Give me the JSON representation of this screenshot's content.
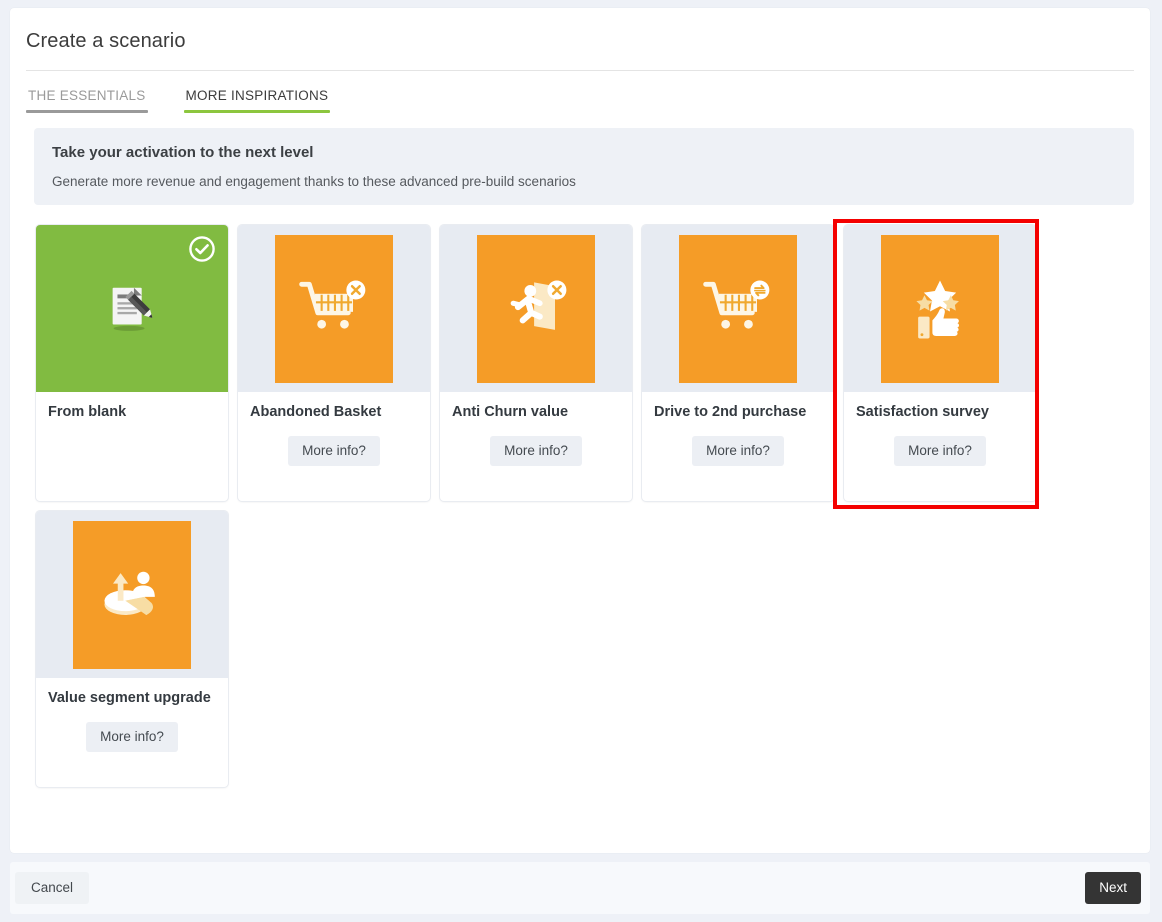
{
  "page": {
    "title": "Create a scenario"
  },
  "tabs": [
    {
      "label": "THE ESSENTIALS",
      "active": false
    },
    {
      "label": "MORE INSPIRATIONS",
      "active": true
    }
  ],
  "banner": {
    "title": "Take your activation to the next level",
    "subtitle": "Generate more revenue and engagement thanks to these advanced pre-build scenarios"
  },
  "cards": [
    {
      "title": "From blank",
      "icon": "document-pencil-icon",
      "tile_color": "#81bb41",
      "selected": true,
      "has_more_info": false,
      "more_info_label": ""
    },
    {
      "title": "Abandoned Basket",
      "icon": "cart-remove-icon",
      "tile_color": "#f59c27",
      "selected": false,
      "has_more_info": true,
      "more_info_label": "More info?"
    },
    {
      "title": "Anti Churn value",
      "icon": "running-person-exit-icon",
      "tile_color": "#f59c27",
      "selected": false,
      "has_more_info": true,
      "more_info_label": "More info?"
    },
    {
      "title": "Drive to 2nd purchase",
      "icon": "cart-repeat-icon",
      "tile_color": "#f59c27",
      "selected": false,
      "has_more_info": true,
      "more_info_label": "More info?"
    },
    {
      "title": "Satisfaction survey",
      "icon": "thumbs-up-stars-icon",
      "tile_color": "#f59c27",
      "selected": false,
      "highlighted": true,
      "has_more_info": true,
      "more_info_label": "More info?"
    },
    {
      "title": "Value segment upgrade",
      "icon": "pie-chart-person-up-icon",
      "tile_color": "#f59c27",
      "selected": false,
      "has_more_info": true,
      "more_info_label": "More info?"
    }
  ],
  "footer": {
    "cancel_label": "Cancel",
    "next_label": "Next"
  },
  "colors": {
    "accent_green": "#8cc63e",
    "tile_orange": "#f59c27",
    "tile_green": "#81bb41",
    "highlight_red": "#f40000",
    "banner_bg": "#eef1f6",
    "page_bg": "#eef1f7"
  }
}
